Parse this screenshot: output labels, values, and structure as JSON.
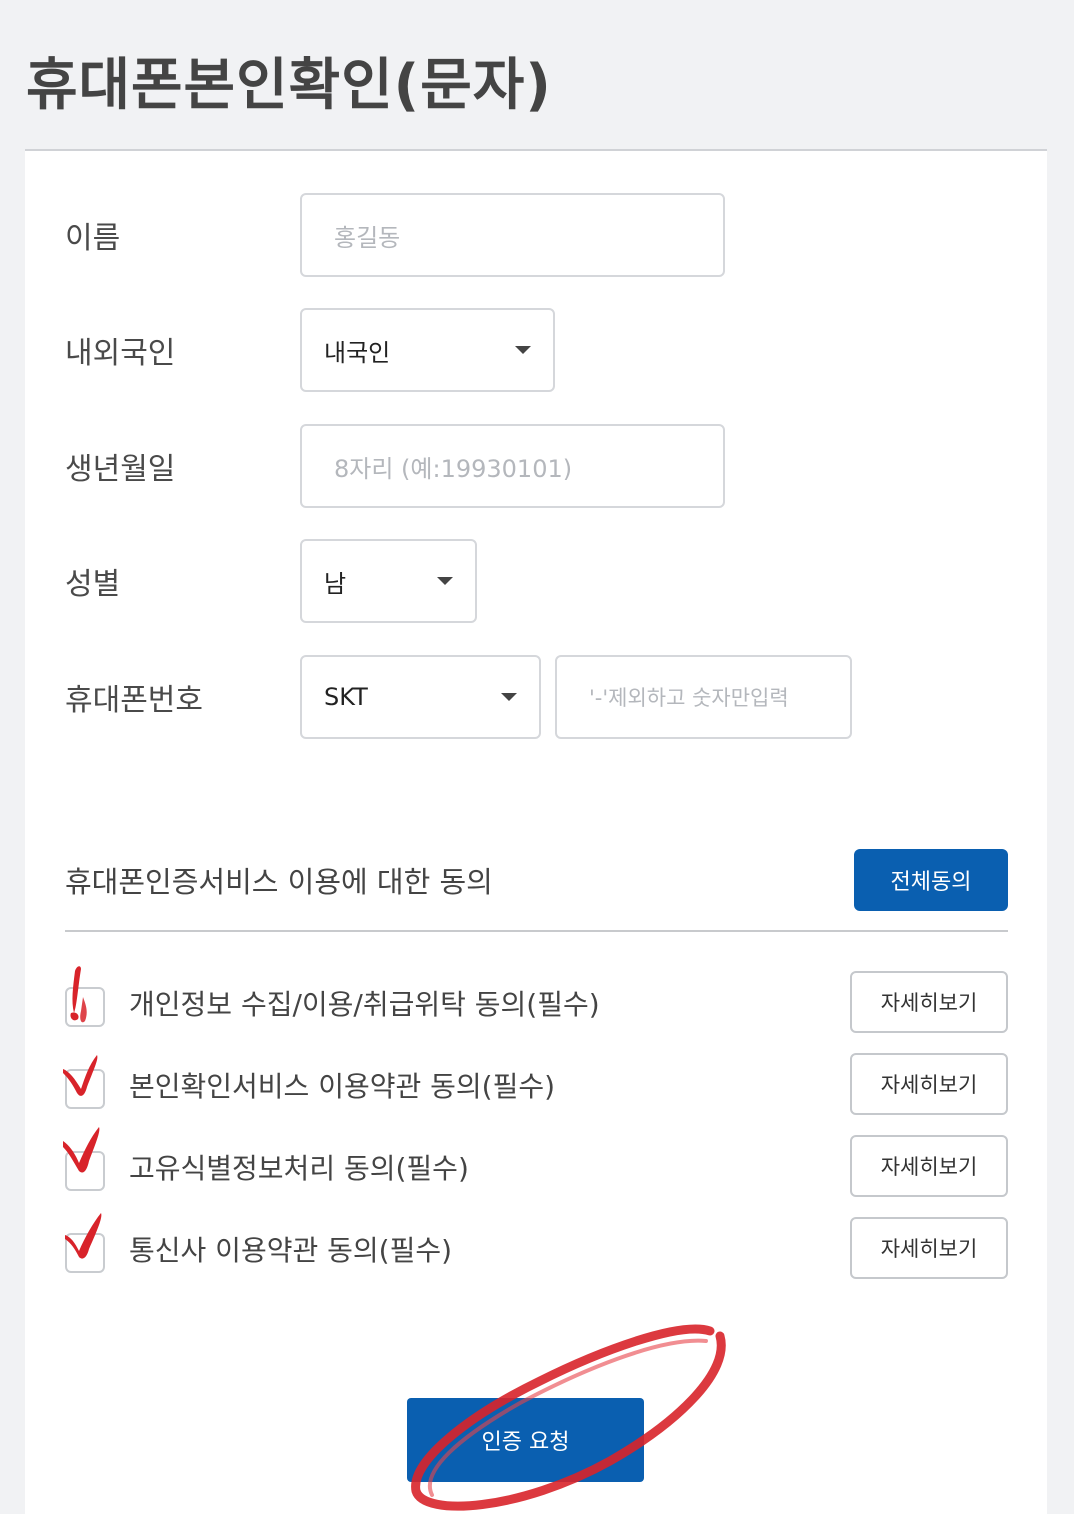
{
  "header": {
    "title": "휴대폰본인확인(문자)"
  },
  "form": {
    "name": {
      "label": "이름",
      "placeholder": "홍길동"
    },
    "nationality": {
      "label": "내외국인",
      "value": "내국인"
    },
    "birth": {
      "label": "생년월일",
      "placeholder": "8자리 (예:19930101)"
    },
    "gender": {
      "label": "성별",
      "value": "남"
    },
    "phone": {
      "label": "휴대폰번호",
      "carrier": "SKT",
      "placeholder": "'-'제외하고 숫자만입력"
    }
  },
  "agreement": {
    "title": "휴대폰인증서비스 이용에 대한 동의",
    "agree_all_label": "전체동의",
    "detail_label": "자세히보기",
    "terms": [
      {
        "label": "개인정보 수집/이용/취급위탁 동의(필수)",
        "checked": true
      },
      {
        "label": "본인확인서비스 이용약관 동의(필수)",
        "checked": true
      },
      {
        "label": "고유식별정보처리 동의(필수)",
        "checked": true
      },
      {
        "label": "통신사 이용약관 동의(필수)",
        "checked": true
      }
    ]
  },
  "submit_label": "인증 요청",
  "colors": {
    "primary": "#0a5fb0",
    "annotation": "#d8232a",
    "background": "#f1f2f4"
  }
}
